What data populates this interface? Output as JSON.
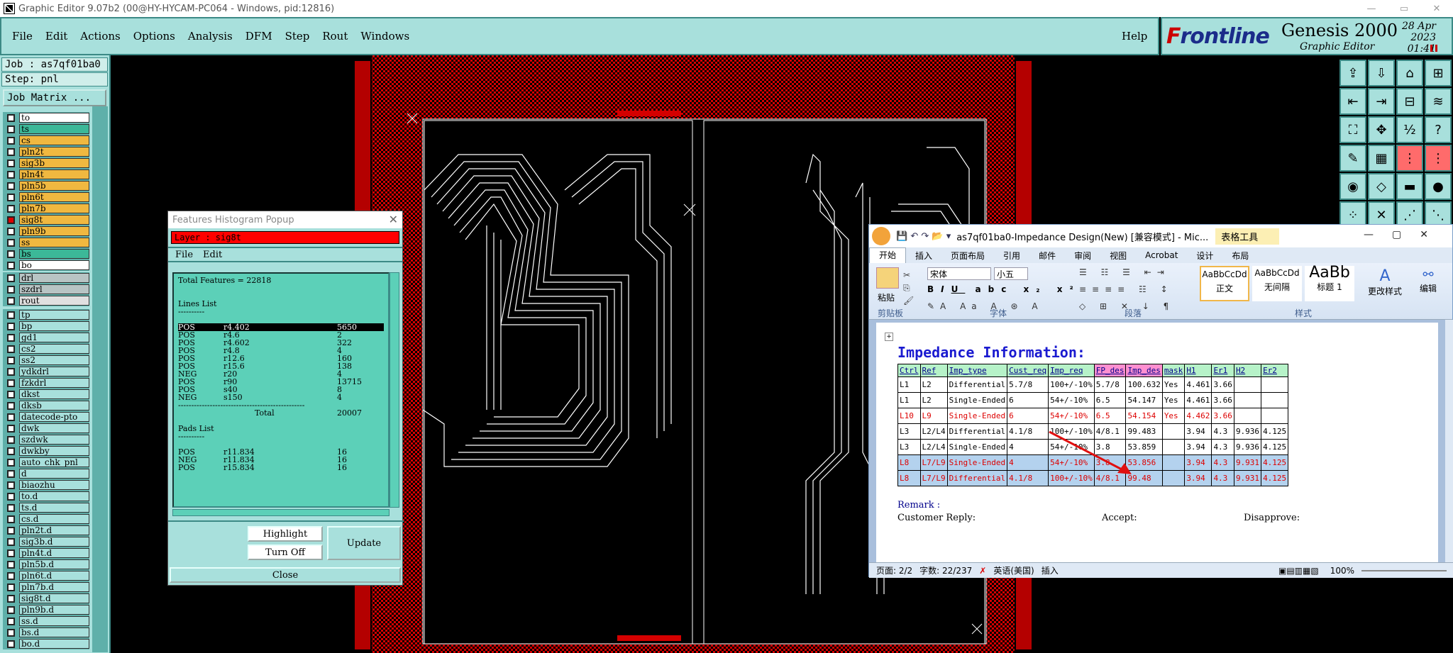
{
  "window": {
    "title": "Graphic Editor 9.07b2 (00@HY-HYCAM-PC064 - Windows, pid:12816)"
  },
  "menu": {
    "items": [
      "File",
      "Edit",
      "Actions",
      "Options",
      "Analysis",
      "DFM",
      "Step",
      "Rout",
      "Windows"
    ],
    "help": "Help"
  },
  "brand": {
    "logo_prefix": "F",
    "logo_rest": "rontline",
    "product": "Genesis 2000",
    "subtitle": "Graphic Editor",
    "date": "28 Apr 2023",
    "time": "01:41 PM"
  },
  "job": {
    "job_line": "Job : as7qf01ba0",
    "step_line": "Step: pnl",
    "matrix_button": "Job Matrix ..."
  },
  "layers": {
    "group1": [
      {
        "name": "to",
        "color": "#ffffff"
      },
      {
        "name": "ts",
        "color": "#3cb898"
      },
      {
        "name": "cs",
        "color": "#f0b840"
      },
      {
        "name": "pln2t",
        "color": "#f0b840"
      },
      {
        "name": "sig3b",
        "color": "#f0b840"
      },
      {
        "name": "pln4t",
        "color": "#f0b840"
      },
      {
        "name": "pln5b",
        "color": "#f0b840"
      },
      {
        "name": "pln6t",
        "color": "#f0b840"
      },
      {
        "name": "pln7b",
        "color": "#f0b840"
      },
      {
        "name": "sig8t",
        "color": "#f0b840",
        "selected": true
      },
      {
        "name": "pln9b",
        "color": "#f0b840"
      },
      {
        "name": "ss",
        "color": "#f0b840"
      },
      {
        "name": "bs",
        "color": "#3cb898"
      },
      {
        "name": "bo",
        "color": "#ffffff"
      }
    ],
    "group2": [
      {
        "name": "drl",
        "color": "#b8c4c4"
      },
      {
        "name": "szdrl",
        "color": "#b8c4c4"
      },
      {
        "name": "rout",
        "color": "#e0e0e0"
      }
    ],
    "group3": [
      {
        "name": "tp",
        "color": "#a8e0dc"
      },
      {
        "name": "bp",
        "color": "#a8e0dc"
      },
      {
        "name": "gd1",
        "color": "#a8e0dc"
      },
      {
        "name": "cs2",
        "color": "#a8e0dc"
      },
      {
        "name": "ss2",
        "color": "#a8e0dc"
      },
      {
        "name": "ydkdrl",
        "color": "#a8e0dc"
      },
      {
        "name": "fzkdrl",
        "color": "#a8e0dc"
      },
      {
        "name": "dkst",
        "color": "#a8e0dc"
      },
      {
        "name": "dksb",
        "color": "#a8e0dc"
      },
      {
        "name": "datecode-pto",
        "color": "#a8e0dc"
      },
      {
        "name": "dwk",
        "color": "#a8e0dc"
      },
      {
        "name": "szdwk",
        "color": "#a8e0dc"
      },
      {
        "name": "dwkby",
        "color": "#a8e0dc"
      },
      {
        "name": "auto_chk_pnl",
        "color": "#a8e0dc"
      },
      {
        "name": "d",
        "color": "#a8e0dc"
      },
      {
        "name": "biaozhu",
        "color": "#a8e0dc"
      },
      {
        "name": "to.d",
        "color": "#a8e0dc"
      },
      {
        "name": "ts.d",
        "color": "#a8e0dc"
      },
      {
        "name": "cs.d",
        "color": "#a8e0dc"
      },
      {
        "name": "pln2t.d",
        "color": "#a8e0dc"
      },
      {
        "name": "sig3b.d",
        "color": "#a8e0dc"
      },
      {
        "name": "pln4t.d",
        "color": "#a8e0dc"
      },
      {
        "name": "pln5b.d",
        "color": "#a8e0dc"
      },
      {
        "name": "pln6t.d",
        "color": "#a8e0dc"
      },
      {
        "name": "pln7b.d",
        "color": "#a8e0dc"
      },
      {
        "name": "sig8t.d",
        "color": "#a8e0dc"
      },
      {
        "name": "pln9b.d",
        "color": "#a8e0dc"
      },
      {
        "name": "ss.d",
        "color": "#a8e0dc"
      },
      {
        "name": "bs.d",
        "color": "#a8e0dc"
      },
      {
        "name": "bo.d",
        "color": "#a8e0dc"
      }
    ]
  },
  "histogram": {
    "title": "Features Histogram Popup",
    "layer": "Layer : sig8t",
    "menu": [
      "File",
      "Edit"
    ],
    "total": "Total Features = 22818",
    "lines_header": "Lines List",
    "dash": "----------",
    "lines": [
      {
        "p": "POS",
        "s": "r4.402",
        "n": "5650",
        "hl": true
      },
      {
        "p": "POS",
        "s": "r4.6",
        "n": "2"
      },
      {
        "p": "POS",
        "s": "r4.602",
        "n": "322"
      },
      {
        "p": "POS",
        "s": "r4.8",
        "n": "4"
      },
      {
        "p": "POS",
        "s": "r12.6",
        "n": "160"
      },
      {
        "p": "POS",
        "s": "r15.6",
        "n": "138"
      },
      {
        "p": "NEG",
        "s": "r20",
        "n": "4"
      },
      {
        "p": "POS",
        "s": "r90",
        "n": "13715"
      },
      {
        "p": "POS",
        "s": "s40",
        "n": "8"
      },
      {
        "p": "NEG",
        "s": "s150",
        "n": "4"
      }
    ],
    "sep": "------------------------------------------------",
    "total_label": "Total",
    "total_value": "20007",
    "pads_header": "Pads List",
    "pads": [
      {
        "p": "POS",
        "s": "r11.834",
        "n": "16"
      },
      {
        "p": "NEG",
        "s": "r11.834",
        "n": "16"
      },
      {
        "p": "POS",
        "s": "r15.834",
        "n": "16"
      }
    ],
    "highlight": "Highlight",
    "turnoff": "Turn Off",
    "update": "Update",
    "close": "Close"
  },
  "word": {
    "title": "as7qf01ba0-Impedance Design(New) [兼容模式] - Mic...",
    "context_tab": "表格工具",
    "tabs": [
      "开始",
      "插入",
      "页面布局",
      "引用",
      "邮件",
      "审阅",
      "视图",
      "Acrobat",
      "设计",
      "布局"
    ],
    "font": "宋体",
    "size": "小五",
    "paste": "粘贴",
    "groups": [
      "剪贴板",
      "字体",
      "段落",
      "样式"
    ],
    "styles": [
      {
        "sample": "AaBbCcDd",
        "name": "正文"
      },
      {
        "sample": "AaBbCcDd",
        "name": "无间隔"
      },
      {
        "sample": "AaBb",
        "name": "标题 1"
      }
    ],
    "change_style": "更改样式",
    "edit": "编辑",
    "heading": "Impedance Information:",
    "headers": [
      "Ctrl",
      "Ref",
      "Imp_type",
      "Cust_req",
      "Imp_req",
      "FP_des",
      "Imp_des",
      "mask",
      "H1",
      "Er1",
      "H2",
      "Er2"
    ],
    "rows": [
      {
        "cls": "",
        "cells": [
          "L1",
          "L2",
          "Differential",
          "5.7/8",
          "100+/-10%",
          "5.7/8",
          "100.632",
          "Yes",
          "4.461",
          "3.66",
          "",
          ""
        ]
      },
      {
        "cls": "",
        "cells": [
          "L1",
          "L2",
          "Single-Ended",
          "6",
          "54+/-10%",
          "6.5",
          "54.147",
          "Yes",
          "4.461",
          "3.66",
          "",
          ""
        ]
      },
      {
        "cls": "red",
        "cells": [
          "L10",
          "L9",
          "Single-Ended",
          "6",
          "54+/-10%",
          "6.5",
          "54.154",
          "Yes",
          "4.462",
          "3.66",
          "",
          ""
        ]
      },
      {
        "cls": "",
        "cells": [
          "L3",
          "L2/L4",
          "Differential",
          "4.1/8",
          "100+/-10%",
          "4/8.1",
          "99.483",
          "",
          "3.94",
          "4.3",
          "9.936",
          "4.125"
        ]
      },
      {
        "cls": "",
        "cells": [
          "L3",
          "L2/L4",
          "Single-Ended",
          "4",
          "54+/-10%",
          "3.8",
          "53.859",
          "",
          "3.94",
          "4.3",
          "9.936",
          "4.125"
        ]
      },
      {
        "cls": "sel",
        "cells": [
          "L8",
          "L7/L9",
          "Single-Ended",
          "4",
          "54+/-10%",
          "3.8",
          "53.856",
          "",
          "3.94",
          "4.3",
          "9.931",
          "4.125"
        ]
      },
      {
        "cls": "sel",
        "cells": [
          "L8",
          "L7/L9",
          "Differential",
          "4.1/8",
          "100+/-10%",
          "4/8.1",
          "99.48",
          "",
          "3.94",
          "4.3",
          "9.931",
          "4.125"
        ]
      }
    ],
    "remark": "Remark :",
    "reply": "Customer Reply:",
    "accept": "Accept:",
    "disapprove": "Disapprove:",
    "status": {
      "page": "页面: 2/2",
      "words": "字数: 22/237",
      "lang": "英语(美国)",
      "mode": "插入",
      "zoom": "100%"
    }
  }
}
